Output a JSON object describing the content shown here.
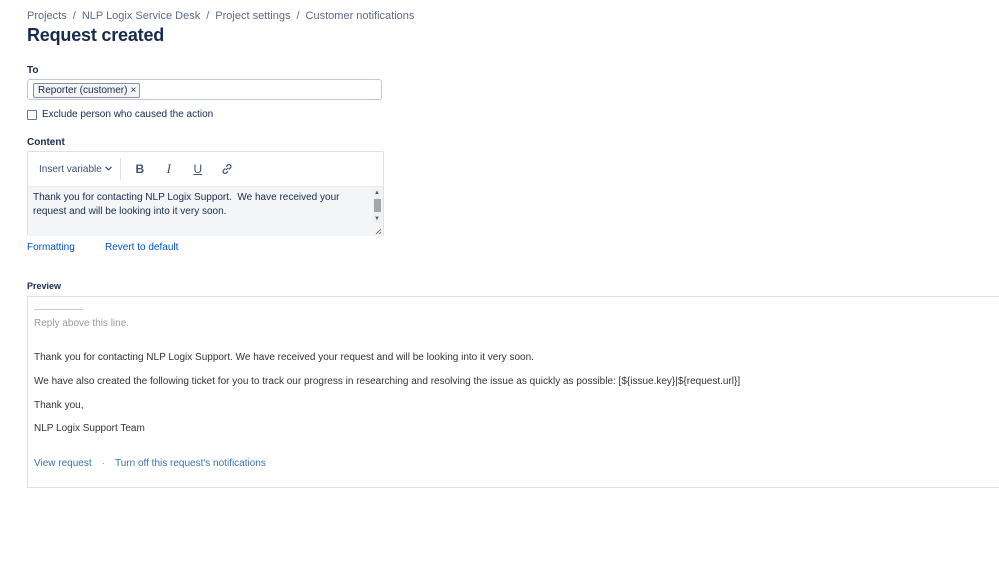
{
  "breadcrumb": {
    "items": [
      "Projects",
      "NLP Logix Service Desk",
      "Project settings",
      "Customer notifications"
    ],
    "separator": "/"
  },
  "page_title": "Request created",
  "to_field": {
    "label": "To",
    "chips": [
      "Reporter (customer)"
    ],
    "chip_remove": "×"
  },
  "exclude_checkbox": {
    "label": "Exclude person who caused the action",
    "checked": false
  },
  "content": {
    "label": "Content",
    "toolbar": {
      "insert_variable": "Insert variable",
      "bold": "B",
      "italic": "I",
      "underline": "U"
    },
    "text": "Thank you for contacting NLP Logix Support.  We have received your request and will be looking into it very soon."
  },
  "links": {
    "formatting": "Formatting",
    "revert": "Revert to default"
  },
  "preview": {
    "label": "Preview",
    "reply_line": "Reply above this line.",
    "paragraphs": [
      "Thank you for contacting NLP Logix Support. We have received your request and will be looking into it very soon.",
      "We have also created the following ticket for you to track our progress in researching and resolving the issue as quickly as possible: [${issue.key}|${request.url}]",
      "Thank you,",
      "NLP Logix Support Team"
    ],
    "footer_links": [
      "View request",
      "Turn off this request's notifications"
    ],
    "footer_separator": "·"
  },
  "colors": {
    "link": "#0052cc",
    "preview_link": "#3b73af",
    "text": "#172b4d"
  }
}
